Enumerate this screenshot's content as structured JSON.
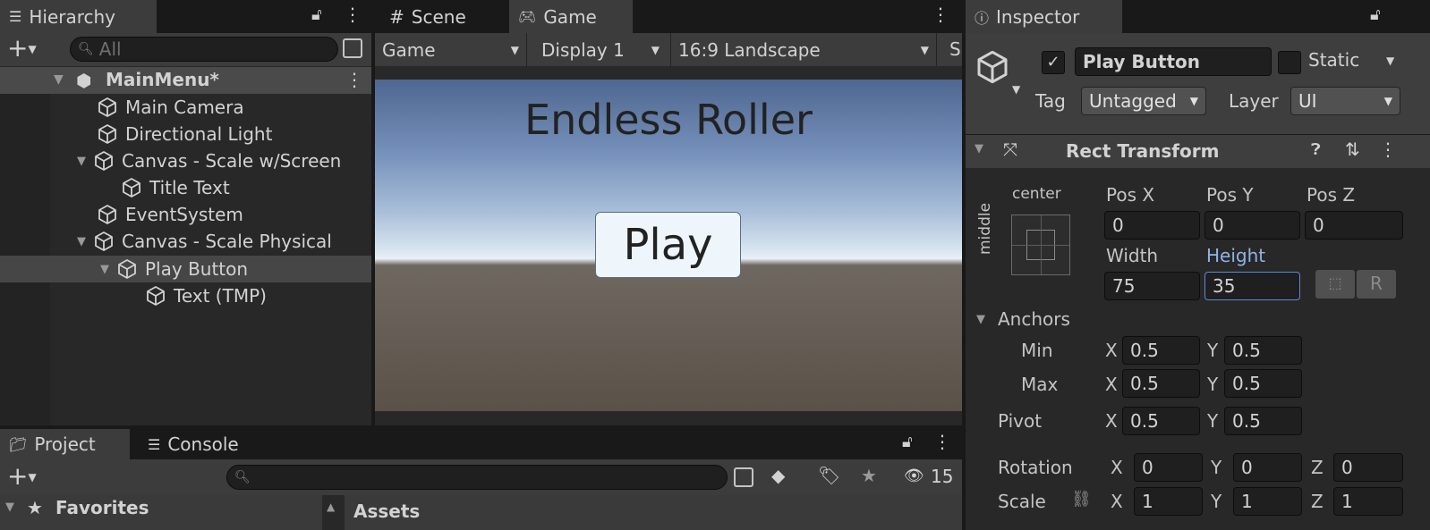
{
  "hierarchy": {
    "tab_label": "Hierarchy",
    "search_placeholder": "All",
    "scene_name": "MainMenu*",
    "items": [
      {
        "label": "Main Camera"
      },
      {
        "label": "Directional Light"
      },
      {
        "label": "Canvas - Scale w/Screen"
      },
      {
        "label": "Title Text"
      },
      {
        "label": "EventSystem"
      },
      {
        "label": "Canvas - Scale Physical"
      },
      {
        "label": "Play Button"
      },
      {
        "label": "Text (TMP)"
      }
    ]
  },
  "center": {
    "tabs": [
      {
        "label": "Scene"
      },
      {
        "label": "Game"
      }
    ],
    "toolbar": {
      "mode": "Game",
      "display": "Display 1",
      "aspect": "16:9 Landscape",
      "cut": "S"
    },
    "game_view": {
      "title": "Endless Roller",
      "button_label": "Play"
    }
  },
  "bottom": {
    "tabs": [
      {
        "label": "Project"
      },
      {
        "label": "Console"
      }
    ],
    "hidden_count": "15",
    "favorites_label": "Favorites",
    "assets_label": "Assets"
  },
  "inspector": {
    "tab_label": "Inspector",
    "object_name": "Play Button",
    "static_label": "Static",
    "tag_label": "Tag",
    "tag_value": "Untagged",
    "layer_label": "Layer",
    "layer_value": "UI",
    "rect_transform": {
      "title": "Rect Transform",
      "anchor_h": "center",
      "anchor_v": "middle",
      "pos_x_label": "Pos X",
      "pos_x": "0",
      "pos_y_label": "Pos Y",
      "pos_y": "0",
      "pos_z_label": "Pos Z",
      "pos_z": "0",
      "width_label": "Width",
      "width": "75",
      "height_label": "Height",
      "height": "35",
      "r_button": "R",
      "anchors_label": "Anchors",
      "min_label": "Min",
      "min_x": "0.5",
      "min_y": "0.5",
      "max_label": "Max",
      "max_x": "0.5",
      "max_y": "0.5",
      "pivot_label": "Pivot",
      "pivot_x": "0.5",
      "pivot_y": "0.5",
      "rotation_label": "Rotation",
      "rot_x": "0",
      "rot_y": "0",
      "rot_z": "0",
      "scale_label": "Scale",
      "scale_x": "1",
      "scale_y": "1",
      "scale_z": "1",
      "x": "X",
      "y": "Y",
      "z": "Z"
    }
  }
}
